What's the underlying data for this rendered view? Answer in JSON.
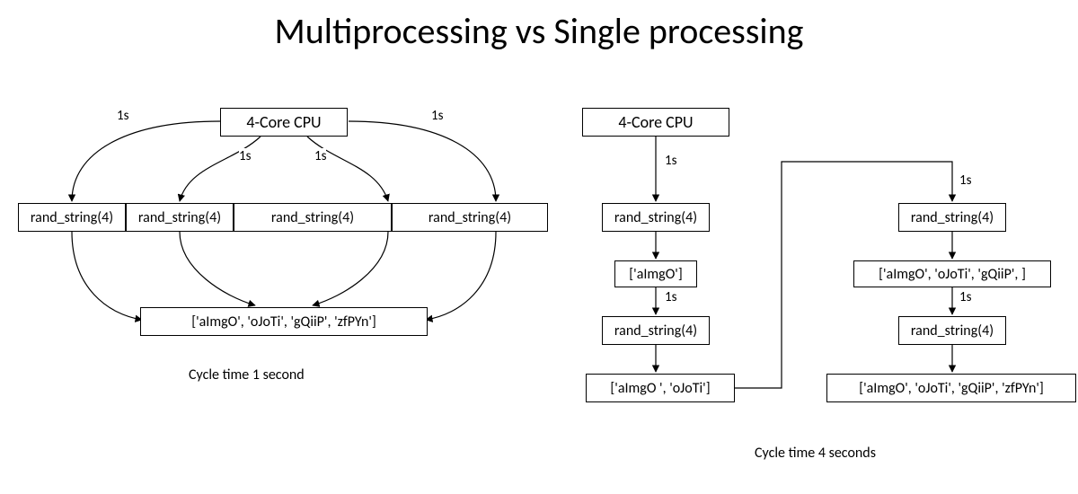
{
  "title": "Multiprocessing vs Single processing",
  "left": {
    "cpu": "4-Core CPU",
    "edge_outer": "1s",
    "edge_inner": "1s",
    "task": "rand_string(4)",
    "result": "['aImgO', 'oJoTi', 'gQiiP', 'zfPYn']",
    "caption": "Cycle time 1 second"
  },
  "right": {
    "cpu": "4-Core CPU",
    "edge": "1s",
    "task": "rand_string(4)",
    "r1": "['aImgO']",
    "r2": "['aImgO ', 'oJoTi']",
    "r3": "['aImgO', 'oJoTi', 'gQiiP', ]",
    "r4": "['aImgO', 'oJoTi', 'gQiiP', 'zfPYn']",
    "caption": "Cycle time 4 seconds"
  }
}
